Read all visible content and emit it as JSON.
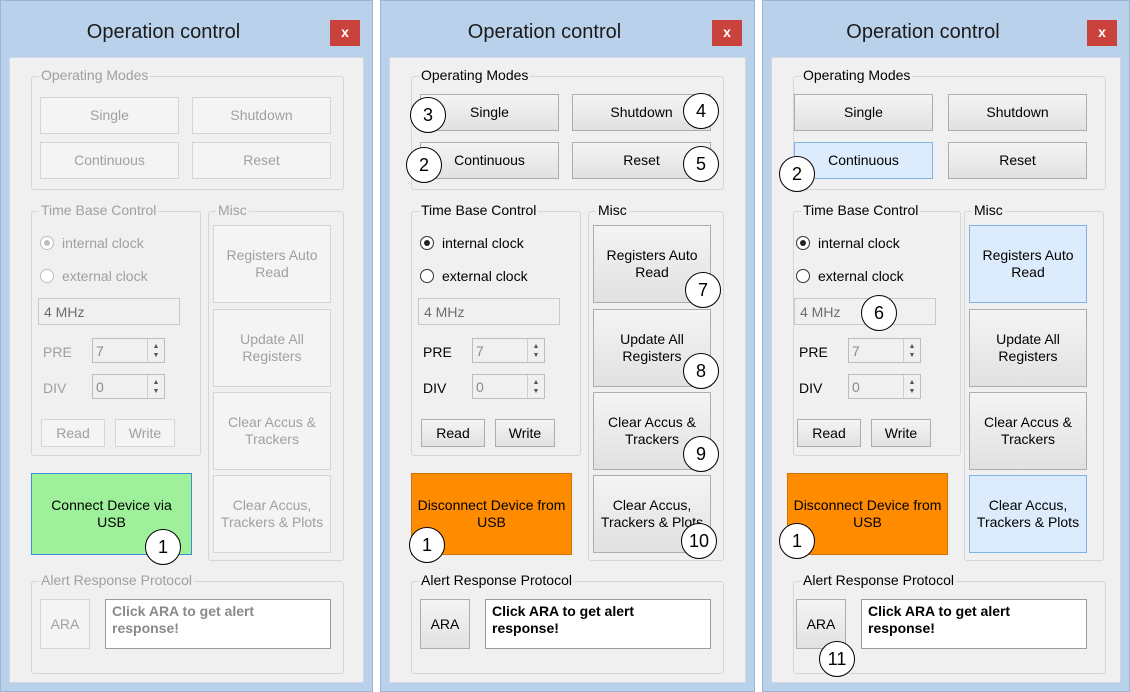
{
  "panels": [
    {
      "title": "Operation control",
      "close_label": "x",
      "operating_modes": {
        "label": "Operating Modes",
        "single": "Single",
        "shutdown": "Shutdown",
        "continuous": "Continuous",
        "reset": "Reset"
      },
      "time_base": {
        "label": "Time Base Control",
        "internal": "internal clock",
        "external": "external clock",
        "freq": "4 MHz",
        "pre_label": "PRE",
        "pre_value": "7",
        "div_label": "DIV",
        "div_value": "0",
        "read": "Read",
        "write": "Write"
      },
      "misc": {
        "label": "Misc",
        "auto_read": "Registers Auto Read",
        "update_all": "Update All Registers",
        "clear_accus": "Clear Accus & Trackers",
        "clear_plots": "Clear Accus, Trackers & Plots"
      },
      "connect": "Connect Device via USB",
      "alert": {
        "label": "Alert Response Protocol",
        "ara": "ARA",
        "message": "Click ARA to get alert response!"
      },
      "callouts": [
        "1"
      ]
    },
    {
      "title": "Operation control",
      "close_label": "x",
      "operating_modes": {
        "label": "Operating Modes",
        "single": "Single",
        "shutdown": "Shutdown",
        "continuous": "Continuous",
        "reset": "Reset"
      },
      "time_base": {
        "label": "Time Base Control",
        "internal": "internal clock",
        "external": "external clock",
        "freq": "4 MHz",
        "pre_label": "PRE",
        "pre_value": "7",
        "div_label": "DIV",
        "div_value": "0",
        "read": "Read",
        "write": "Write"
      },
      "misc": {
        "label": "Misc",
        "auto_read": "Registers Auto Read",
        "update_all": "Update All Registers",
        "clear_accus": "Clear Accus & Trackers",
        "clear_plots": "Clear Accus, Trackers & Plots"
      },
      "connect": "Disconnect Device from USB",
      "alert": {
        "label": "Alert Response Protocol",
        "ara": "ARA",
        "message": "Click ARA to get alert response!"
      },
      "callouts": [
        "3",
        "4",
        "2",
        "5",
        "7",
        "8",
        "9",
        "1",
        "10"
      ]
    },
    {
      "title": "Operation control",
      "close_label": "x",
      "operating_modes": {
        "label": "Operating Modes",
        "single": "Single",
        "shutdown": "Shutdown",
        "continuous": "Continuous",
        "reset": "Reset"
      },
      "time_base": {
        "label": "Time Base Control",
        "internal": "internal clock",
        "external": "external clock",
        "freq": "4 MHz",
        "pre_label": "PRE",
        "pre_value": "7",
        "div_label": "DIV",
        "div_value": "0",
        "read": "Read",
        "write": "Write"
      },
      "misc": {
        "label": "Misc",
        "auto_read": "Registers Auto Read",
        "update_all": "Update All Registers",
        "clear_accus": "Clear Accus & Trackers",
        "clear_plots": "Clear Accus, Trackers & Plots"
      },
      "connect": "Disconnect Device from USB",
      "alert": {
        "label": "Alert Response Protocol",
        "ara": "ARA",
        "message": "Click ARA to get alert response!"
      },
      "callouts": [
        "2",
        "6",
        "1",
        "11"
      ]
    }
  ],
  "colors": {
    "frame": "#b9d1ea",
    "close": "#c9423c",
    "connect_green": "#9ef09a",
    "disconnect_orange": "#ff8c00",
    "selected_blue": "#dcecfc"
  }
}
